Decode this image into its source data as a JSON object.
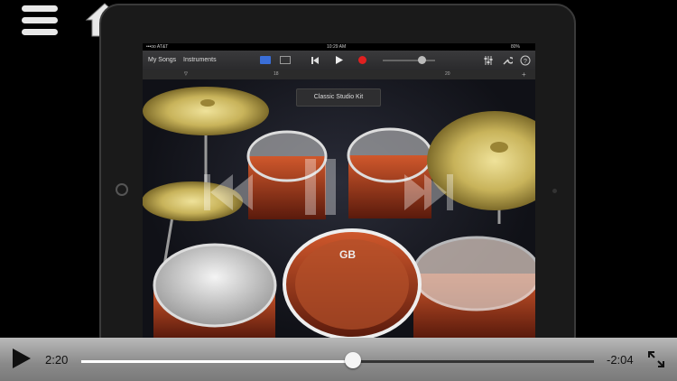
{
  "player": {
    "elapsed": "2:20",
    "remaining": "-2:04",
    "progress": 0.53
  },
  "ios_status": {
    "carrier": "•••oo AT&T",
    "time": "10:29 AM",
    "battery": "80%"
  },
  "garageband": {
    "my_songs": "My Songs",
    "instruments": "Instruments",
    "kit_name": "Classic Studio Kit",
    "ruler_marks": [
      "18",
      "20"
    ],
    "drum_logo": "GB"
  },
  "icons": {
    "menu": "list-menu-icon",
    "home": "home-icon",
    "play": "play-icon",
    "expand": "expand-icon"
  },
  "colors": {
    "record": "#e02020",
    "cymbal": "#c8b35a",
    "drum_shell": "#a23a1c"
  }
}
